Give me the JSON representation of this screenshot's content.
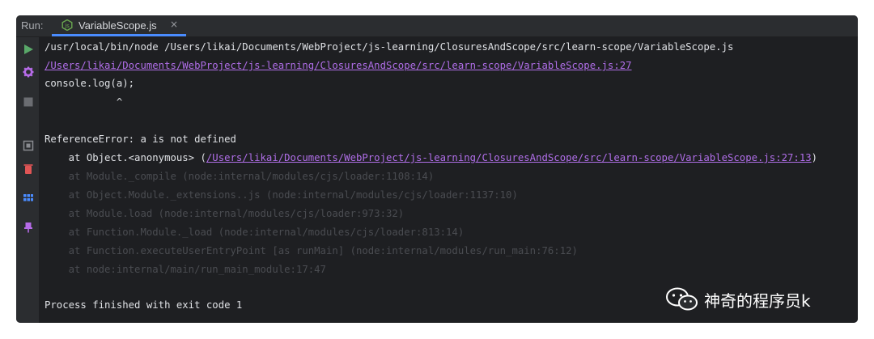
{
  "run_label": "Run:",
  "tab": {
    "title": "VariableScope.js",
    "close": "×"
  },
  "gutter_icons": [
    "run-icon",
    "settings-icon",
    "stop-icon",
    "dump-icon",
    "delete-icon",
    "layout-icon",
    "pin-icon"
  ],
  "console": {
    "command": "/usr/local/bin/node /Users/likai/Documents/WebProject/js-learning/ClosuresAndScope/src/learn-scope/VariableScope.js",
    "error_location": "/Users/likai/Documents/WebProject/js-learning/ClosuresAndScope/src/learn-scope/VariableScope.js:27",
    "source_line": "console.log(a);",
    "caret_line": "            ^",
    "error_message": "ReferenceError: a is not defined",
    "stack_first_prefix": "    at Object.<anonymous> (",
    "stack_first_link": "/Users/likai/Documents/WebProject/js-learning/ClosuresAndScope/src/learn-scope/VariableScope.js:27:13",
    "stack_first_suffix": ")",
    "stack_dim": [
      "    at Module._compile (node:internal/modules/cjs/loader:1108:14)",
      "    at Object.Module._extensions..js (node:internal/modules/cjs/loader:1137:10)",
      "    at Module.load (node:internal/modules/cjs/loader:973:32)",
      "    at Function.Module._load (node:internal/modules/cjs/loader:813:14)",
      "    at Function.executeUserEntryPoint [as runMain] (node:internal/modules/run_main:76:12)",
      "    at node:internal/main/run_main_module:17:47"
    ],
    "exit": "Process finished with exit code 1"
  },
  "watermark": {
    "text": "神奇的程序员k"
  },
  "colors": {
    "link": "#b06ee8",
    "tab_underline": "#4a8cff",
    "run_green": "#59a869",
    "delete_red": "#e05555",
    "pin_purple": "#b66be8"
  }
}
